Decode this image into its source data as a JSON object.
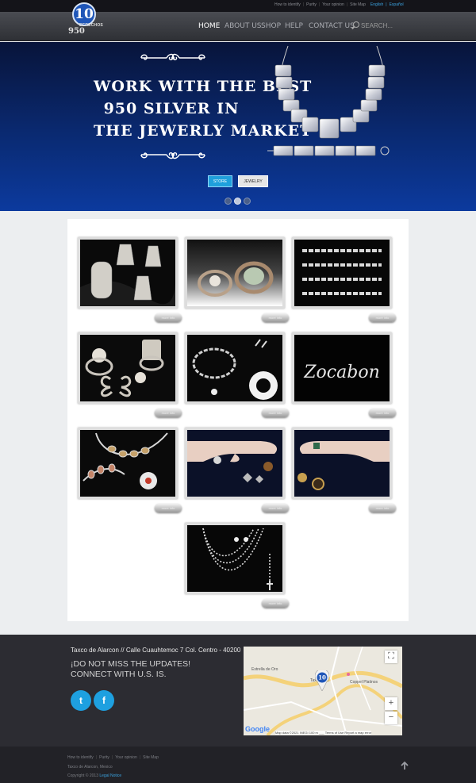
{
  "topbar": {
    "links": [
      "How to identify",
      "Purity",
      "Your opinion",
      "Site Map"
    ],
    "languages": [
      "English",
      "Español"
    ]
  },
  "logo": {
    "mark": "10",
    "subtitle": "DERECHOS",
    "number": "950"
  },
  "nav": {
    "items": [
      "HOME",
      "ABOUT US",
      "SHOP",
      "HELP",
      "CONTACT US"
    ],
    "active": "HOME",
    "search_placeholder": "SEARCH..."
  },
  "hero": {
    "title_lines": [
      "WORK WITH THE BEST",
      "950 SILVER IN",
      "THE JEWERLY MARKET"
    ],
    "buttons": [
      "STORE",
      "JEWELRY"
    ],
    "slides": 3,
    "active_slide": 2
  },
  "gallery": {
    "more_label": "more info",
    "items": [
      {
        "id": "earrings-rings"
      },
      {
        "id": "rings-stones"
      },
      {
        "id": "bracelets-chains"
      },
      {
        "id": "butterfly-rings"
      },
      {
        "id": "chain-bracelet-pendant"
      },
      {
        "id": "zocabon",
        "text": "Zocabon"
      },
      {
        "id": "colored-necklace"
      },
      {
        "id": "hand-rings-left"
      },
      {
        "id": "hand-rings-right"
      },
      {
        "id": "bead-necklaces"
      }
    ]
  },
  "footer": {
    "address": "Taxco de Alarcon // Calle Cuauhtemoc 7 Col. Centro - 40200",
    "cta_line1": "¡DO NOT MISS THE UPDATES!",
    "cta_line2": "CONNECT WITH U.S. IS.",
    "social": [
      {
        "icon": "twitter-icon",
        "glyph": "t"
      },
      {
        "icon": "facebook-icon",
        "glyph": "f"
      }
    ],
    "map": {
      "labels": [
        "Estrella de Oro",
        "Taxco de...",
        "Coppel Platinos"
      ],
      "attribution": "Map data ©2021 INEGI   100 m ___   Terms of Use   Report a map error",
      "google": "Google"
    }
  },
  "footer2": {
    "links": [
      "How to identify",
      "Purity",
      "Your opinion",
      "Site Map"
    ],
    "location": "Taxco de Alarcon, Mexico",
    "copyright_prefix": "Copyright © 2013",
    "copyright_link": "Legal Notice"
  },
  "colors": {
    "accent": "#1fa0dc",
    "hero_top": "#08143a",
    "hero_bottom": "#0c3a9e",
    "footer": "#2c2c32"
  }
}
